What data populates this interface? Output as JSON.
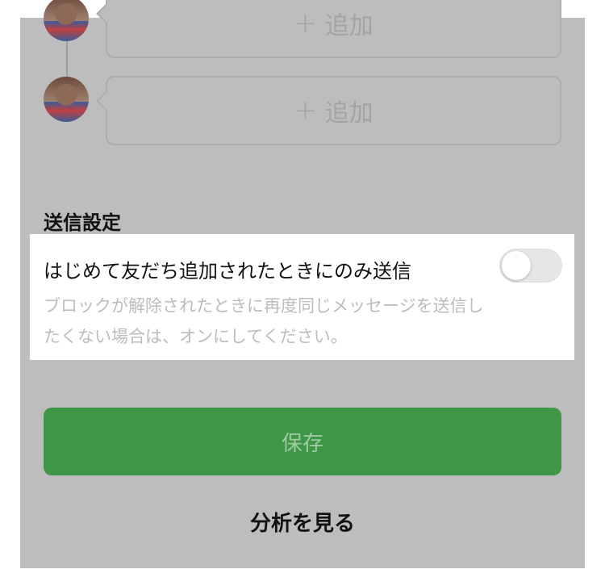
{
  "messages": {
    "items": [
      {
        "add_label": "追加"
      },
      {
        "add_label": "追加"
      }
    ]
  },
  "send_settings": {
    "title": "送信設定",
    "first_add_only": {
      "label": "はじめて友だち追加されたときにのみ送信",
      "description": "ブロックが解除されたときに再度同じメッセージを送信したくない場合は、オンにしてください。",
      "enabled": false
    }
  },
  "actions": {
    "save_label": "保存",
    "analysis_label": "分析を見る"
  },
  "colors": {
    "overlay": "#bdbdbd",
    "save_button": "#3f9647",
    "card": "#ffffff"
  }
}
